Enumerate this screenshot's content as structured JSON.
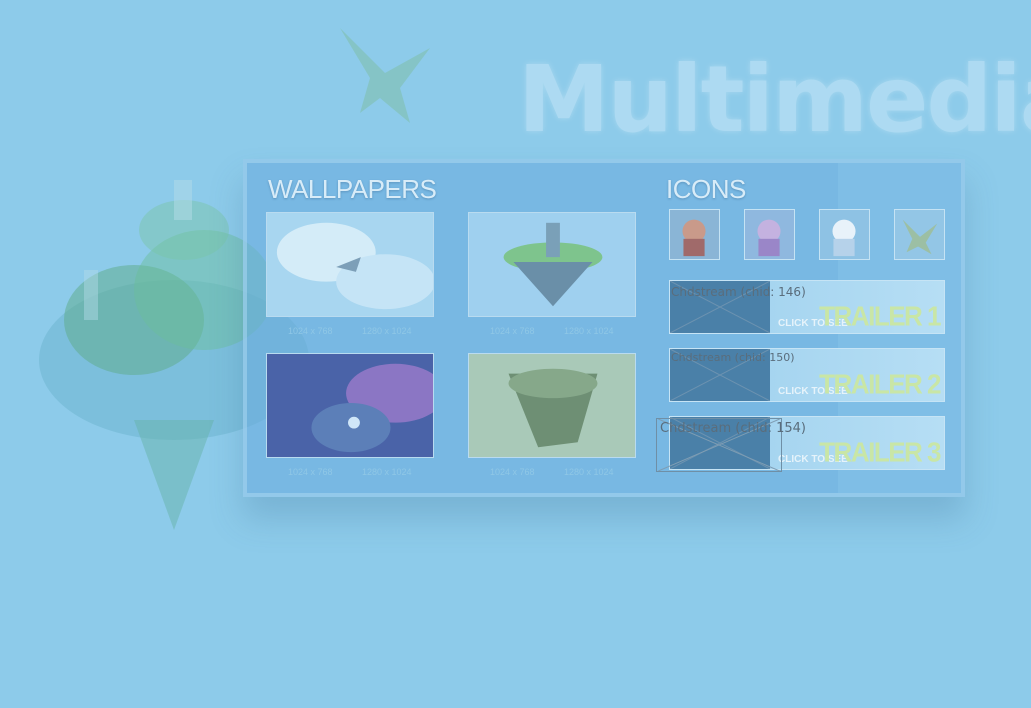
{
  "page": {
    "title": "Multimedia"
  },
  "wallpapers": {
    "heading": "WALLPAPERS",
    "items": [
      {
        "res": [
          "1024 x 768",
          "1280 x 1024"
        ]
      },
      {
        "res": [
          "1024 x 768",
          "1280 x 1024"
        ]
      },
      {
        "res": [
          "1024 x 768",
          "1280 x 1024"
        ]
      },
      {
        "res": [
          "1024 x 768",
          "1280 x 1024"
        ]
      }
    ]
  },
  "icons": {
    "heading": "ICONS"
  },
  "trailers": [
    {
      "cta": "CLICK TO SEE",
      "label": "TRAILER 1",
      "stream": "Chdstream (chid: 146)"
    },
    {
      "cta": "CLICK TO SEE",
      "label": "TRAILER 2",
      "stream": "Chdstream (chid: 150)"
    },
    {
      "cta": "CLICK TO SEE",
      "label": "TRAILER 3",
      "stream": "Chdstream (chid: 154)"
    }
  ],
  "colors": {
    "background": "#8dcbea",
    "panel": "#68aadc",
    "trailer_text": "#c9e6a6"
  },
  "icon_names": [
    "floating-island-decor",
    "flying-bird-decor"
  ]
}
